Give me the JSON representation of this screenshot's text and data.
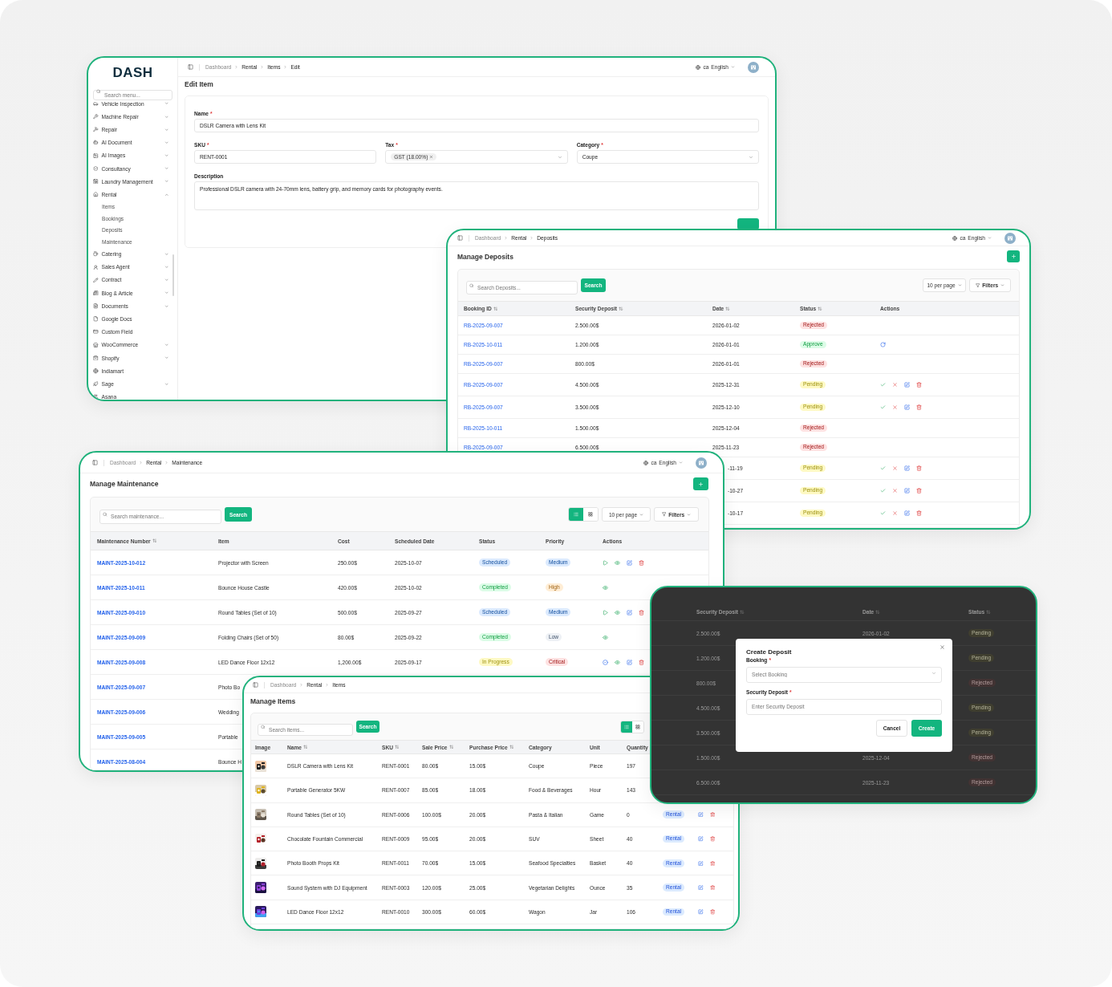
{
  "edit_item_window": {
    "logo": "DASH",
    "menu_search": {
      "placeholder": "Search menu..."
    },
    "menu": [
      {
        "label": "Vehicle Inspection",
        "expandable": true,
        "expanded": false
      },
      {
        "label": "Machine Repair",
        "expandable": true,
        "expanded": false
      },
      {
        "label": "Repair",
        "expandable": true,
        "expanded": false
      },
      {
        "label": "AI Document",
        "expandable": true,
        "expanded": false
      },
      {
        "label": "AI Images",
        "expandable": true,
        "expanded": false
      },
      {
        "label": "Consultancy",
        "expandable": true,
        "expanded": false
      },
      {
        "label": "Laundry Management",
        "expandable": true,
        "expanded": false
      },
      {
        "label": "Rental",
        "expandable": true,
        "expanded": true,
        "children": [
          {
            "label": "Items"
          },
          {
            "label": "Bookings"
          },
          {
            "label": "Deposits"
          },
          {
            "label": "Maintenance"
          }
        ]
      },
      {
        "label": "Catering",
        "expandable": true,
        "expanded": false
      },
      {
        "label": "Sales Agent",
        "expandable": true,
        "expanded": false
      },
      {
        "label": "Contract",
        "expandable": true,
        "expanded": false
      },
      {
        "label": "Blog & Article",
        "expandable": true,
        "expanded": false
      },
      {
        "label": "Documents",
        "expandable": true,
        "expanded": false
      },
      {
        "label": "Google Docs",
        "expandable": false,
        "expanded": false
      },
      {
        "label": "Custom Field",
        "expandable": false,
        "expanded": false
      },
      {
        "label": "WooCommerce",
        "expandable": true,
        "expanded": false
      },
      {
        "label": "Shopify",
        "expandable": true,
        "expanded": false
      },
      {
        "label": "Indiamart",
        "expandable": false,
        "expanded": false
      },
      {
        "label": "Sage",
        "expandable": true,
        "expanded": false
      },
      {
        "label": "Asana",
        "expandable": false,
        "expanded": false
      }
    ],
    "breadcrumb": [
      "Dashboard",
      "Rental",
      "Items",
      "Edit"
    ],
    "language": {
      "code": "ca",
      "name": "English"
    },
    "title": "Edit Item",
    "name": {
      "label": "Name",
      "required_mark": "*",
      "value": "DSLR Camera with Lens Kit"
    },
    "sku": {
      "label": "SKU",
      "required_mark": "*",
      "value": "RENT-0001"
    },
    "tax": {
      "label": "Tax",
      "required_mark": "*",
      "chips": [
        "GST (18.00%)"
      ]
    },
    "category": {
      "label": "Category",
      "required_mark": "*",
      "value": "Coupe"
    },
    "description": {
      "label": "Description",
      "value": "Professional DSLR camera with 24-70mm lens, battery grip, and memory cards for photography events."
    }
  },
  "deposits_window": {
    "breadcrumb": [
      "Dashboard",
      "Rental",
      "Deposits"
    ],
    "language": {
      "code": "ca",
      "name": "English"
    },
    "title": "Manage Deposits",
    "search": {
      "placeholder": "Search Deposits..."
    },
    "search_button": "Search",
    "per_page": "10 per page",
    "filters": "Filters",
    "columns": [
      {
        "label": "Booking ID",
        "sortable": true
      },
      {
        "label": "Security Deposit",
        "sortable": true
      },
      {
        "label": "Date",
        "sortable": true
      },
      {
        "label": "Status",
        "sortable": true
      },
      {
        "label": "Actions",
        "sortable": false
      }
    ],
    "rows": [
      {
        "booking_id": "RB-2025-09-007",
        "amount": "2.500.00$",
        "date": "2026-01-02",
        "status": {
          "label": "Rejected",
          "color": "#fee2e2"
        }
      },
      {
        "booking_id": "RB-2025-10-011",
        "amount": "1.200.00$",
        "date": "2026-01-01",
        "status": {
          "label": "Approve",
          "color": "#dcfce7"
        },
        "actions": {
          "kind": "restore"
        }
      },
      {
        "booking_id": "RB-2025-09-007",
        "amount": "800.00$",
        "date": "2026-01-01",
        "status": {
          "label": "Rejected",
          "color": "#fee2e2"
        }
      },
      {
        "booking_id": "RB-2025-09-007",
        "amount": "4.500.00$",
        "date": "2025-12-31",
        "status": {
          "label": "Pending",
          "color": "#fef9c3"
        },
        "actions": {
          "kind": "review"
        }
      },
      {
        "booking_id": "RB-2025-09-007",
        "amount": "3.500.00$",
        "date": "2025-12-10",
        "status": {
          "label": "Pending",
          "color": "#fef9c3"
        },
        "actions": {
          "kind": "review"
        }
      },
      {
        "booking_id": "RB-2025-10-011",
        "amount": "1.500.00$",
        "date": "2025-12-04",
        "status": {
          "label": "Rejected",
          "color": "#fee2e2"
        }
      },
      {
        "booking_id": "RB-2025-09-007",
        "amount": "6.500.00$",
        "date": "2025-11-23",
        "status": {
          "label": "Rejected",
          "color": "#fee2e2"
        }
      },
      {
        "date": "-11-19",
        "status": {
          "label": "Pending",
          "color": "#fef9c3"
        },
        "actions": {
          "kind": "review"
        }
      },
      {
        "date": "-10-27",
        "status": {
          "label": "Pending",
          "color": "#fef9c3"
        },
        "actions": {
          "kind": "review"
        }
      },
      {
        "date": "-10-17",
        "status": {
          "label": "Pending",
          "color": "#fef9c3"
        },
        "actions": {
          "kind": "review"
        }
      }
    ]
  },
  "maintenance_window": {
    "breadcrumb": [
      "Dashboard",
      "Rental",
      "Maintenance"
    ],
    "language": {
      "code": "ca",
      "name": "English"
    },
    "title": "Manage Maintenance",
    "search": {
      "placeholder": "Search maintenance..."
    },
    "search_button": "Search",
    "view_toggle": [
      {
        "kind": "list",
        "selected": true
      },
      {
        "kind": "grid",
        "selected": false
      }
    ],
    "per_page": "10 per page",
    "filters": "Filters",
    "columns": [
      {
        "label": "Maintenance Number",
        "sortable": true
      },
      {
        "label": "Item",
        "sortable": false
      },
      {
        "label": "Cost",
        "sortable": false
      },
      {
        "label": "Scheduled Date",
        "sortable": false
      },
      {
        "label": "Status",
        "sortable": false
      },
      {
        "label": "Priority",
        "sortable": false
      },
      {
        "label": "Actions",
        "sortable": false
      }
    ],
    "rows": [
      {
        "number": "MAINT-2025-10-012",
        "item": "Projector with Screen",
        "cost": "250.00$",
        "date": "2025-10-07",
        "status": {
          "label": "Scheduled",
          "color": "#dbeafe"
        },
        "priority": {
          "label": "Medium",
          "color": "#dbeafe"
        },
        "actions": {
          "kind": "scheduled"
        }
      },
      {
        "number": "MAINT-2025-10-011",
        "item": "Bounce House Castle",
        "cost": "420.00$",
        "date": "2025-10-02",
        "status": {
          "label": "Completed",
          "color": "#dcfce7"
        },
        "priority": {
          "label": "High",
          "color": "#ffedd5"
        },
        "actions": {
          "kind": "view"
        }
      },
      {
        "number": "MAINT-2025-09-010",
        "item": "Round Tables (Set of 10)",
        "cost": "500.00$",
        "date": "2025-09-27",
        "status": {
          "label": "Scheduled",
          "color": "#dbeafe"
        },
        "priority": {
          "label": "Medium",
          "color": "#dbeafe"
        },
        "actions": {
          "kind": "scheduled"
        }
      },
      {
        "number": "MAINT-2025-09-009",
        "item": "Folding Chairs (Set of 50)",
        "cost": "80.00$",
        "date": "2025-09-22",
        "status": {
          "label": "Completed",
          "color": "#dcfce7"
        },
        "priority": {
          "label": "Low",
          "color": "#eef1f5"
        },
        "actions": {
          "kind": "view"
        }
      },
      {
        "number": "MAINT-2025-09-008",
        "item": "LED Dance Floor 12x12",
        "cost": "1,200.00$",
        "date": "2025-09-17",
        "status": {
          "label": "In Progress",
          "color": "#fef9c3"
        },
        "priority": {
          "label": "Critical",
          "color": "#fee2e2"
        },
        "actions": {
          "kind": "progress"
        }
      },
      {
        "number": "MAINT-2025-09-007",
        "item": "Photo Bo"
      },
      {
        "number": "MAINT-2025-09-006",
        "item": "Wedding"
      },
      {
        "number": "MAINT-2025-09-005",
        "item": "Portable"
      },
      {
        "number": "MAINT-2025-08-004",
        "item": "Bounce H"
      }
    ]
  },
  "items_window": {
    "breadcrumb": [
      "Dashboard",
      "Rental",
      "Items"
    ],
    "title": "Manage Items",
    "search": {
      "placeholder": "Search items..."
    },
    "search_button": "Search",
    "view_toggle": [
      {
        "kind": "list",
        "selected": true
      },
      {
        "kind": "grid",
        "selected": false
      }
    ],
    "columns": [
      {
        "label": "Image",
        "sortable": false
      },
      {
        "label": "Name",
        "sortable": true
      },
      {
        "label": "SKU",
        "sortable": true
      },
      {
        "label": "Sale Price",
        "sortable": true
      },
      {
        "label": "Purchase Price",
        "sortable": true
      },
      {
        "label": "Category",
        "sortable": false
      },
      {
        "label": "Unit",
        "sortable": false
      },
      {
        "label": "Quantity",
        "sortable": false
      }
    ],
    "rows": [
      {
        "name": "DSLR Camera with Lens Kit",
        "sku": "RENT-0001",
        "sale": "80.00$",
        "purchase": "15.00$",
        "category": "Coupe",
        "unit": "Piece",
        "quantity": "197",
        "actions": false
      },
      {
        "name": "Portable Generator 5KW",
        "sku": "RENT-0007",
        "sale": "85.00$",
        "purchase": "18.00$",
        "category": "Food & Beverages",
        "unit": "Hour",
        "quantity": "143",
        "actions": false
      },
      {
        "name": "Round Tables (Set of 10)",
        "sku": "RENT-0006",
        "sale": "100.00$",
        "purchase": "20.00$",
        "category": "Pasta & Italian",
        "unit": "Game",
        "quantity": "0",
        "type": "Rental",
        "actions": true
      },
      {
        "name": "Chocolate Fountain Commercial",
        "sku": "RENT-0009",
        "sale": "95.00$",
        "purchase": "20.00$",
        "category": "SUV",
        "unit": "Sheet",
        "quantity": "40",
        "type": "Rental",
        "actions": true
      },
      {
        "name": "Photo Booth Props Kit",
        "sku": "RENT-0011",
        "sale": "70.00$",
        "purchase": "15.00$",
        "category": "Seafood Specialties",
        "unit": "Basket",
        "quantity": "40",
        "type": "Rental",
        "actions": true
      },
      {
        "name": "Sound System with DJ Equipment",
        "sku": "RENT-0003",
        "sale": "120.00$",
        "purchase": "25.00$",
        "category": "Vegetarian Delights",
        "unit": "Ounce",
        "quantity": "35",
        "type": "Rental",
        "actions": true
      },
      {
        "name": "LED Dance Floor 12x12",
        "sku": "RENT-0010",
        "sale": "300.00$",
        "purchase": "60.00$",
        "category": "Wagon",
        "unit": "Jar",
        "quantity": "106",
        "type": "Rental",
        "actions": true
      }
    ]
  },
  "create_deposit_window": {
    "columns": [
      {
        "label": "Security Deposit",
        "sortable": true
      },
      {
        "label": "Date",
        "sortable": true
      },
      {
        "label": "Status",
        "sortable": true
      }
    ],
    "rows": [
      {
        "amount": "2.500.00$",
        "date": "2026-01-02",
        "status": {
          "label": "Pending",
          "color": "#3f3e2f"
        }
      },
      {
        "amount": "1.200.00$",
        "status": {
          "label": "Pending",
          "color": "#3f3e2f"
        }
      },
      {
        "amount": "800.00$",
        "status": {
          "label": "Rejected",
          "color": "#423333"
        }
      },
      {
        "amount": "4.500.00$",
        "status": {
          "label": "Pending",
          "color": "#3f3e2f"
        }
      },
      {
        "amount": "3.500.00$",
        "status": {
          "label": "Pending",
          "color": "#3f3e2f"
        }
      },
      {
        "amount": "1.500.00$",
        "date": "2025-12-04",
        "status": {
          "label": "Rejected",
          "color": "#423333"
        }
      },
      {
        "amount": "6.500.00$",
        "date": "2025-11-23",
        "status": {
          "label": "Rejected",
          "color": "#423333"
        }
      }
    ],
    "modal": {
      "title": "Create Deposit",
      "booking": {
        "label": "Booking",
        "required_mark": "*",
        "placeholder": "Select Booking"
      },
      "deposit": {
        "label": "Security Deposit",
        "required_mark": "*",
        "placeholder": "Enter Security Deposit"
      },
      "cancel": "Cancel",
      "create": "Create"
    }
  }
}
